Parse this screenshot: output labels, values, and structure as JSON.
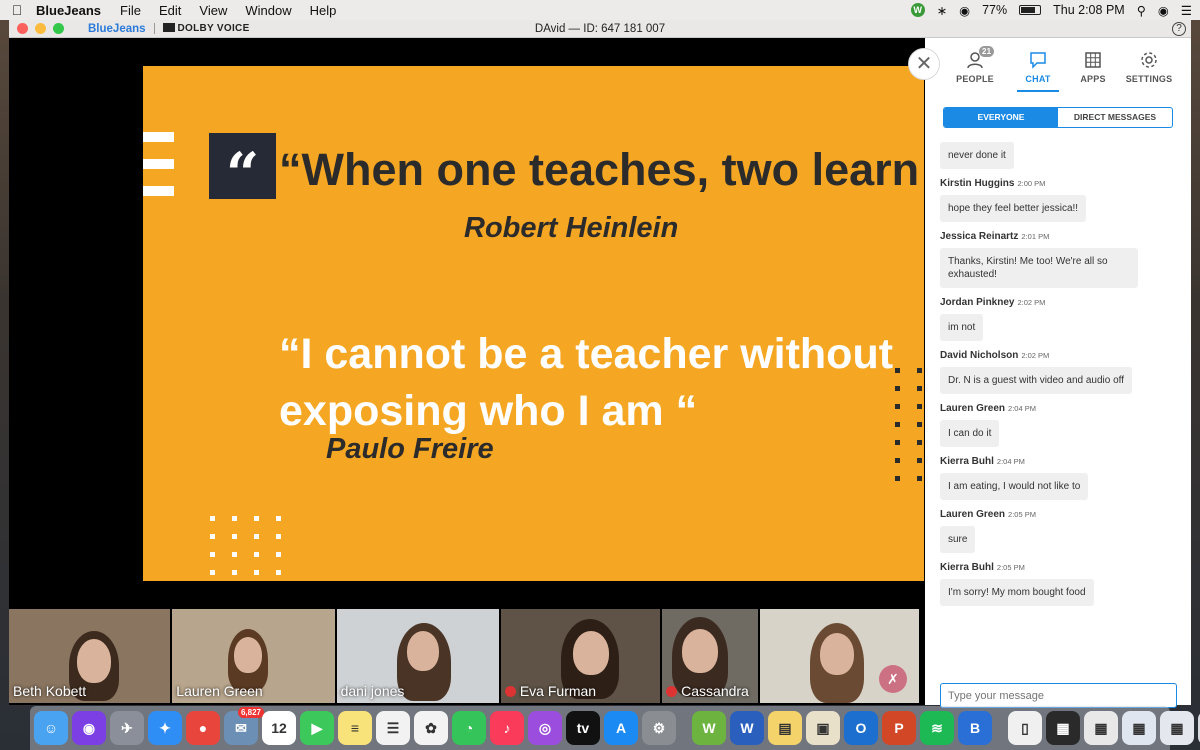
{
  "menubar": {
    "app_name": "BlueJeans",
    "menus": [
      "File",
      "Edit",
      "View",
      "Window",
      "Help"
    ],
    "battery": "77%",
    "clock": "Thu 2:08 PM",
    "w_badge": "W"
  },
  "window": {
    "brand": "BlueJeans",
    "dolby": "DOLBY VOICE",
    "title": "DAvid — ID: 647 181 007",
    "help": "?"
  },
  "slide": {
    "quote_mark": "“",
    "quote1": "“When one teaches, two learn “",
    "author1": "Robert Heinlein",
    "quote2": "“I cannot be a teacher without exposing who I am “",
    "author2": "Paulo Freire"
  },
  "panel": {
    "close": "✕",
    "nav": [
      {
        "label": "PEOPLE",
        "badge": "21"
      },
      {
        "label": "CHAT"
      },
      {
        "label": "APPS"
      },
      {
        "label": "SETTINGS"
      }
    ],
    "tabs": [
      "EVERYONE",
      "DIRECT MESSAGES"
    ],
    "input_placeholder": "Type your message",
    "messages": [
      {
        "name": "",
        "time": "",
        "text": "never done it"
      },
      {
        "name": "Kirstin Huggins",
        "time": "2:00 PM",
        "text": "hope they feel better jessica!!"
      },
      {
        "name": "Jessica Reinartz",
        "time": "2:01 PM",
        "text": "Thanks, Kirstin! Me too! We're all so exhausted!"
      },
      {
        "name": "Jordan Pinkney",
        "time": "2:02 PM",
        "text": "im not"
      },
      {
        "name": "David Nicholson",
        "time": "2:02 PM",
        "text": "Dr. N is a guest with video and audio off"
      },
      {
        "name": "Lauren Green",
        "time": "2:04 PM",
        "text": "I can do it"
      },
      {
        "name": "Kierra Buhl",
        "time": "2:04 PM",
        "text": "I am eating, I would not like to"
      },
      {
        "name": "Lauren Green",
        "time": "2:05 PM",
        "text": "sure"
      },
      {
        "name": "Kierra Buhl",
        "time": "2:05 PM",
        "text": "I'm sorry! My mom bought food"
      }
    ]
  },
  "participants": [
    {
      "name": "Beth Kobett",
      "muted": false,
      "bg": "#8a7560"
    },
    {
      "name": "Lauren Green",
      "muted": false,
      "bg": "#b8a58d"
    },
    {
      "name": "dani jones",
      "muted": false,
      "bg": "#cfd2d4"
    },
    {
      "name": "Eva Furman",
      "muted": true,
      "bg": "#5e5346"
    },
    {
      "name": "Cassandra",
      "muted": true,
      "bg": "#6f6a62"
    },
    {
      "name": "",
      "muted": false,
      "bg": "#d8d3c8"
    }
  ],
  "dock": {
    "apps": [
      {
        "name": "finder",
        "color": "#4aa3f0",
        "glyph": "☺"
      },
      {
        "name": "siri",
        "color": "#7b3fe4",
        "glyph": "◉"
      },
      {
        "name": "launchpad",
        "color": "#8a8f99",
        "glyph": "✈"
      },
      {
        "name": "safari",
        "color": "#2f8ef5",
        "glyph": "✦"
      },
      {
        "name": "chrome",
        "color": "#e8453c",
        "glyph": "●"
      },
      {
        "name": "photos-mail",
        "color": "#6b8fb5",
        "glyph": "✉",
        "badge": "6,827"
      },
      {
        "name": "calendar",
        "color": "#ffffff",
        "glyph": "12"
      },
      {
        "name": "facetime",
        "color": "#3cc85a",
        "glyph": "▶"
      },
      {
        "name": "notes",
        "color": "#f8e27a",
        "glyph": "≡"
      },
      {
        "name": "reminders",
        "color": "#f2f2f2",
        "glyph": "☰"
      },
      {
        "name": "photos",
        "color": "#f3f3f3",
        "glyph": "✿"
      },
      {
        "name": "messages",
        "color": "#35c45a",
        "glyph": "◔"
      },
      {
        "name": "music",
        "color": "#fa3c5a",
        "glyph": "♪"
      },
      {
        "name": "podcasts",
        "color": "#9b4dde",
        "glyph": "◎"
      },
      {
        "name": "tv",
        "color": "#111111",
        "glyph": "tv"
      },
      {
        "name": "app-store",
        "color": "#1b8af2",
        "glyph": "A"
      },
      {
        "name": "system-preferences",
        "color": "#8a8d92",
        "glyph": "⚙"
      },
      {
        "name": "sep"
      },
      {
        "name": "w-app",
        "color": "#6cb33f",
        "glyph": "W"
      },
      {
        "name": "word",
        "color": "#2b5fbd",
        "glyph": "W"
      },
      {
        "name": "stickies",
        "color": "#f4d36a",
        "glyph": "▤"
      },
      {
        "name": "preview",
        "color": "#e8e0c9",
        "glyph": "▣"
      },
      {
        "name": "outlook",
        "color": "#1c6fcf",
        "glyph": "O"
      },
      {
        "name": "powerpoint",
        "color": "#d24726",
        "glyph": "P"
      },
      {
        "name": "spotify",
        "color": "#1db954",
        "glyph": "≋"
      },
      {
        "name": "bluejeans",
        "color": "#2a6fd6",
        "glyph": "B"
      },
      {
        "name": "sep"
      },
      {
        "name": "document",
        "color": "#f0f0f0",
        "glyph": "▯"
      },
      {
        "name": "window-thumb-1",
        "color": "#2a2a2a",
        "glyph": "▦"
      },
      {
        "name": "window-thumb-2",
        "color": "#e8e8e8",
        "glyph": "▦"
      },
      {
        "name": "window-thumb-3",
        "color": "#dfe6ef",
        "glyph": "▦"
      },
      {
        "name": "window-thumb-4",
        "color": "#e4e8ee",
        "glyph": "▦"
      },
      {
        "name": "trash",
        "color": "#d9dde2",
        "glyph": "🗑"
      }
    ]
  }
}
